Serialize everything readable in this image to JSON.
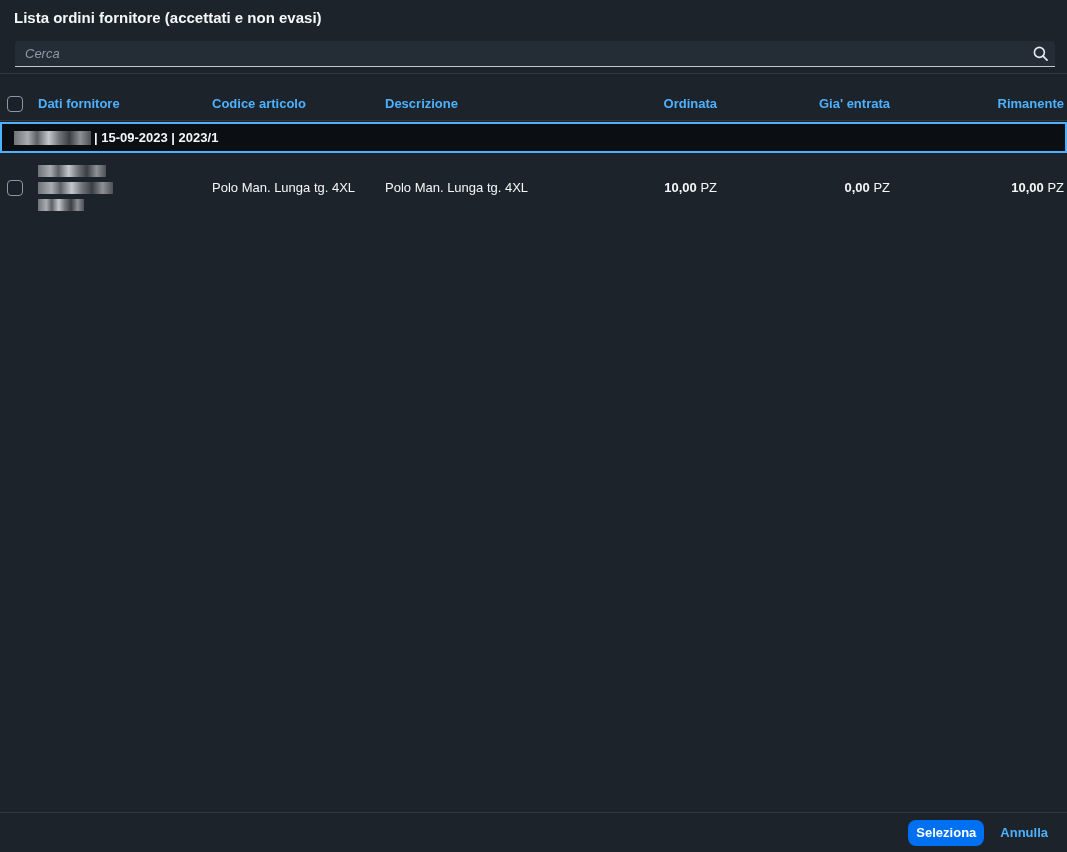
{
  "dialog": {
    "title": "Lista ordini fornitore (accettati e non evasi)"
  },
  "search": {
    "placeholder": "Cerca"
  },
  "table": {
    "select_all": {
      "checked": false
    },
    "columns": [
      {
        "label": "Dati fornitore",
        "kind": "text"
      },
      {
        "label": "Codice articolo",
        "kind": "text"
      },
      {
        "label": "Descrizione",
        "kind": "text"
      },
      {
        "label": "Ordinata",
        "kind": "quantity"
      },
      {
        "label": "Gia' entrata",
        "kind": "quantity"
      },
      {
        "label": "Rimanente",
        "kind": "quantity"
      }
    ],
    "groups": [
      {
        "focused": true,
        "prefix_redacted": true,
        "label": "| 15-09-2023 | 2023/1",
        "rows": [
          {
            "selected": false,
            "supplier": [
              {
                "redacted": true
              },
              {
                "redacted": true
              },
              {
                "redacted": true
              }
            ],
            "cells": [
              "Polo Man. Lunga tg. 4XL",
              "Polo Man. Lunga tg. 4XL",
              "**10,00** PZ",
              "**0,00** PZ",
              "**10,00** PZ"
            ]
          }
        ]
      }
    ]
  },
  "buttons": [
    {
      "label": "Seleziona",
      "kind": "primary"
    },
    {
      "label": "Annulla",
      "kind": "link"
    }
  ]
}
